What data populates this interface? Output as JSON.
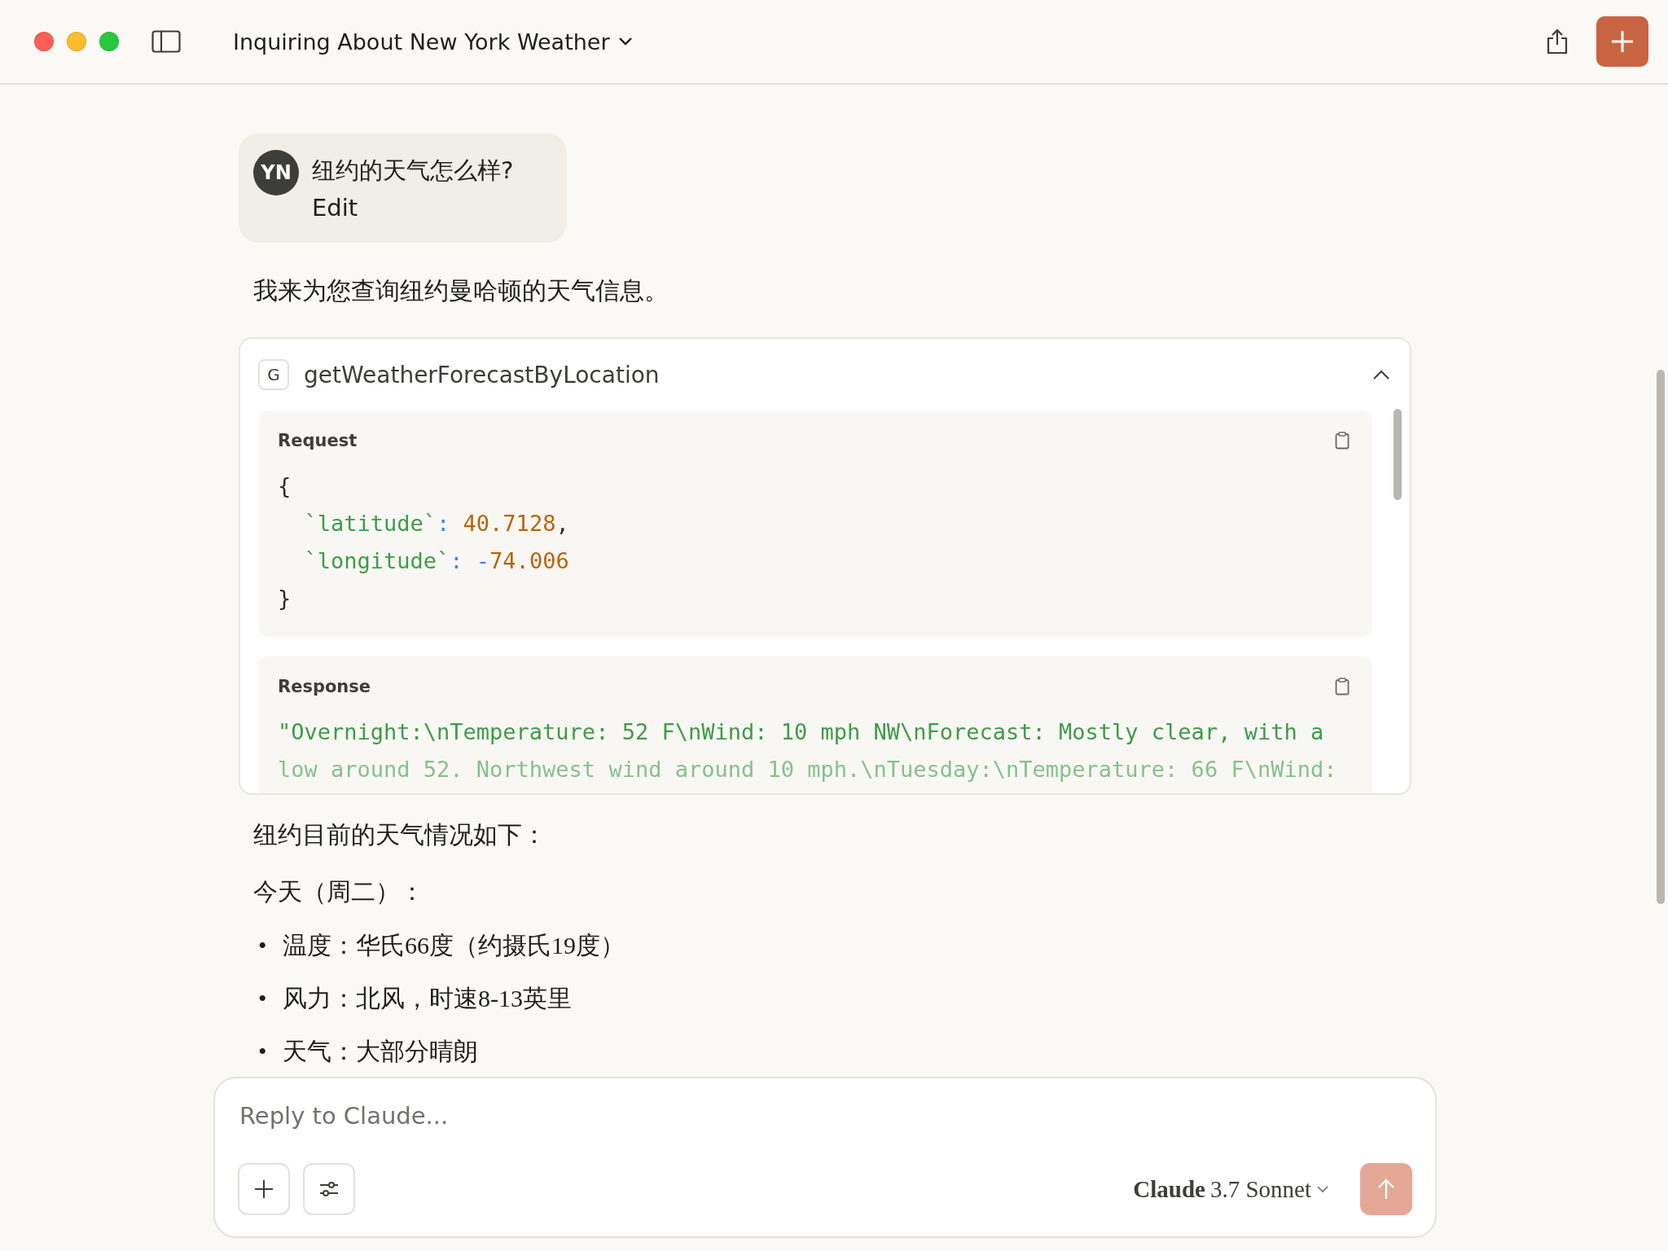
{
  "window": {
    "title": "Inquiring About New York Weather"
  },
  "user_message": {
    "avatar": "YN",
    "text": "纽约的天气怎么样?",
    "edit": "Edit"
  },
  "assistant_intro": "我来为您查询纽约曼哈顿的天气信息。",
  "tool_call": {
    "icon_letter": "G",
    "name": "getWeatherForecastByLocation",
    "expanded": true,
    "request": {
      "label": "Request",
      "lines": [
        [
          {
            "kind": "punct",
            "text": "{"
          }
        ],
        [
          {
            "kind": "key",
            "text": "  `latitude`"
          },
          {
            "kind": "op",
            "text": ":"
          },
          {
            "kind": "num",
            "text": " 40.7128"
          },
          {
            "kind": "punct",
            "text": ","
          }
        ],
        [
          {
            "kind": "key",
            "text": "  `longitude`"
          },
          {
            "kind": "op",
            "text": ":"
          },
          {
            "kind": "op",
            "text": " -"
          },
          {
            "kind": "num",
            "text": "74.006"
          }
        ],
        [
          {
            "kind": "punct",
            "text": "}"
          }
        ]
      ]
    },
    "response": {
      "label": "Response",
      "lines": [
        "\"Overnight:\\nTemperature: 52 F\\nWind: 10 mph NW\\nForecast: Mostly clear, with a",
        "low around 52. Northwest wind around 10 mph.\\nTuesday:\\nTemperature: 66 F\\nWind:"
      ]
    }
  },
  "answer": {
    "marker": "•",
    "summary": "纽约目前的天气情况如下：",
    "heading": "今天（周二）：",
    "bullets": [
      "温度：华氏66度（约摄氏19度）",
      "风力：北风，时速8-13英里",
      "天气：大部分晴朗"
    ]
  },
  "composer": {
    "placeholder": "Reply to Claude...",
    "model": {
      "brand": "Claude",
      "version": "3.7 Sonnet"
    }
  }
}
